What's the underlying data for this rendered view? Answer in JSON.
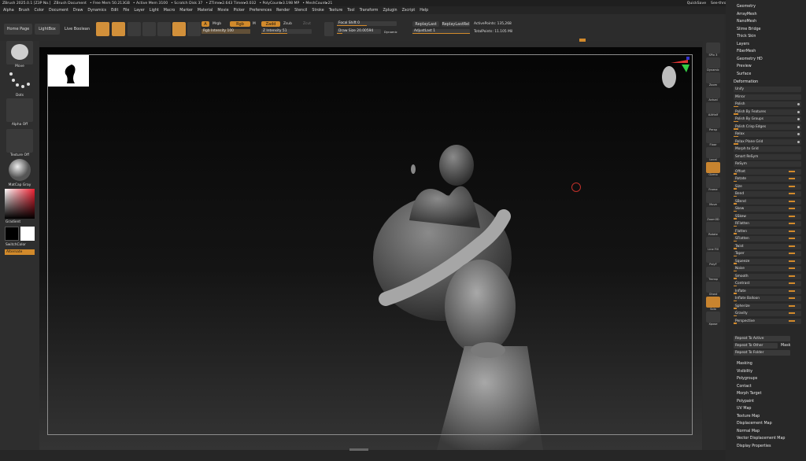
{
  "title_segments": [
    "ZBrush 2025.0.1 [Z3P No.]",
    "ZBrush Document",
    "• Free Mem 50.213GB",
    "• Active Mem 3100",
    "• Scratch Disk 37",
    "• ZTime▸2.643 Timer▸0.032",
    "• PolyCount▸3.198 MP",
    "• MeshCount▸21"
  ],
  "topright": {
    "quicksave": "QuickSave",
    "see_through": "See-through 0",
    "menus": "Menus",
    "script": "DefaultZScript"
  },
  "menu": [
    "Alpha",
    "Brush",
    "Color",
    "Document",
    "Draw",
    "Dynamics",
    "Edit",
    "File",
    "Layer",
    "Light",
    "Macro",
    "Marker",
    "Material",
    "Movie",
    "Picker",
    "Preferences",
    "Render",
    "Stencil",
    "Stroke",
    "Texture",
    "Tool",
    "Transform",
    "Zplugin",
    "Zscript",
    "Help"
  ],
  "toolbar": {
    "home": "Home Page",
    "lightbox": "LightBox",
    "live_boolean": "Live Boolean",
    "edit": "Edit",
    "draw": "Draw",
    "move": "Move",
    "scale": "Scale",
    "rotate": "Rotate",
    "a": "A",
    "mrgb": "Mrgb",
    "rgb": "Rgb",
    "m": "M",
    "zadd": "Zadd",
    "zsub": "Zsub",
    "zcut": "Zcut",
    "rgb_intensity": "Rgb Intensity 100",
    "z_intensity": "Z Intensity 51",
    "focal_shift": "Focal Shift 0",
    "draw_size": "Draw Size 20.00594",
    "dynamic": "Dynamic",
    "replay_last": "ReplayLast",
    "replay_last_rel": "ReplayLastRel",
    "adjust_last": "AdjustLast 1",
    "active_points": "ActivePoints: 135,268",
    "total_points": "TotalPoints: 11.105 Mil"
  },
  "lefttray": {
    "brush": "Move",
    "stroke": "Dots",
    "alpha": "Alpha Off",
    "texture": "Texture Off",
    "material": "MatCap Gray",
    "gradient": "Gradient",
    "switch": "SwitchColor",
    "alternate": "Alternate"
  },
  "rightshelf": [
    "SPix 3",
    "Dynamic",
    "Zoom",
    "Actual",
    "AAHalf",
    "Persp",
    "Floor",
    "Local",
    "Gizmo",
    "Frame",
    "Move",
    "Zoom3D",
    "Rotate",
    "Line Fill",
    "PolyF",
    "Transp",
    "Ghost",
    "Solo",
    "Xpose"
  ],
  "rightpanel": {
    "top_items": [
      "Geometry",
      "ArrayMesh",
      "NanoMesh",
      "Slime Bridge",
      "Thick Skin",
      "Layers",
      "FiberMesh",
      "Geometry HD",
      "Preview",
      "Surface",
      "Deformation"
    ],
    "deform_rows": [
      "Unify",
      "Mirror",
      "Polish",
      "Polish By Features",
      "Polish By Groups",
      "Polish Crisp Edges",
      "Relax",
      "Relax Plane Grid",
      "Morph to Grid",
      "Smart ReSym",
      "ReSym",
      "Offset",
      "Rotate",
      "Size",
      "Bend",
      "SBend",
      "Skew",
      "SSkew",
      "RFlatten",
      "Flatten",
      "SFlatten",
      "Twist",
      "Taper",
      "Squeeze",
      "Noise",
      "Smooth",
      "Contrast",
      "Inflate",
      "Inflate Balloon",
      "Spherize",
      "Gravity",
      "Perspective"
    ],
    "repeat_active": "Repeat To Active",
    "repeat_other": "Repeat To Other",
    "mask": "Mask",
    "repeat_folder": "Repeat To Folder",
    "bottom_items": [
      "Masking",
      "Visibility",
      "Polygroups",
      "Contact",
      "Morph Target",
      "Polypaint",
      "UV Map",
      "Texture Map",
      "Displacement Map",
      "Normal Map",
      "Vector Displacement Map",
      "Display Properties"
    ]
  },
  "colors": {
    "accent": "#d28a2b",
    "panel": "#282828"
  }
}
